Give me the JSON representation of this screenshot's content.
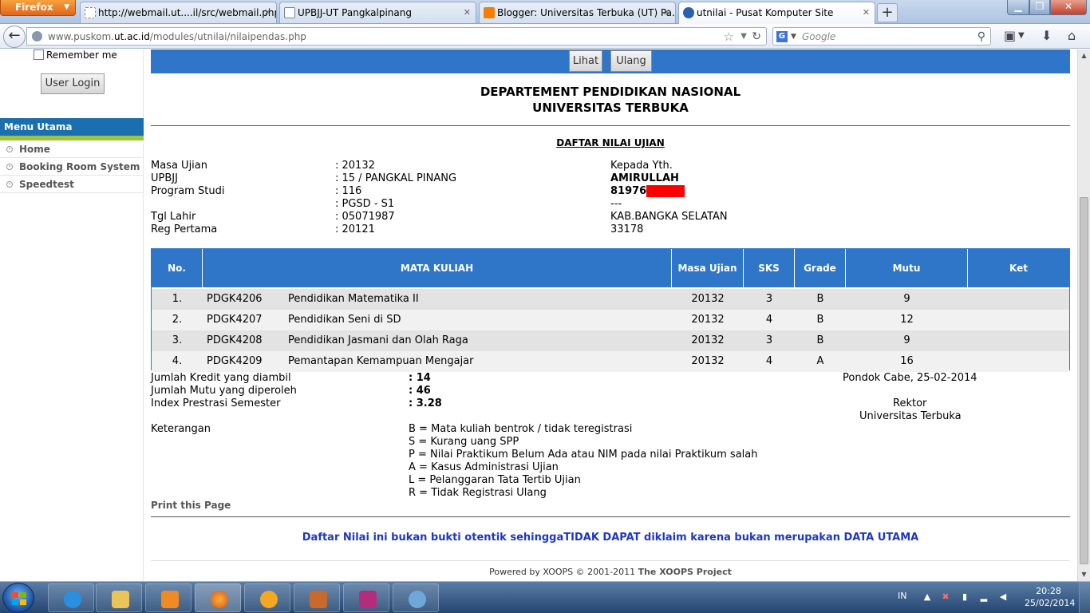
{
  "browser": {
    "firefox_label": "Firefox",
    "tabs": [
      {
        "title": "http://webmail.ut....il/src/webmail.php"
      },
      {
        "title": "UPBJJ-UT Pangkalpinang"
      },
      {
        "title": "Blogger: Universitas Terbuka (UT) Pa..."
      },
      {
        "title": "utnilai - Pusat Komputer Site"
      }
    ],
    "url_prefix": "www.puskom.",
    "url_domain": "ut.ac.id",
    "url_suffix": "/modules/utnilai/nilaipendas.php",
    "search_placeholder": "Google",
    "search_engine_letter": "G"
  },
  "sidebar": {
    "remember_label": "Remember me",
    "login_label": "User Login",
    "menu_title": "Menu Utama",
    "items": [
      {
        "label": "Home"
      },
      {
        "label": "Booking Room System"
      },
      {
        "label": "Speedtest"
      }
    ]
  },
  "page": {
    "btn_lihat": "Lihat",
    "btn_ulang": "Ulang",
    "dept_line1": "DEPARTEMENT PENDIDIKAN NASIONAL",
    "dept_line2": "UNIVERSITAS TERBUKA",
    "daftar_title": "DAFTAR NILAI UJIAN",
    "info": {
      "masa_label": "Masa Ujian",
      "masa_value": ": 20132",
      "upbjj_label": "UPBJJ",
      "upbjj_value": ": 15 / PANGKAL PINANG",
      "prodi_label": "Program Studi",
      "prodi_value": ": 116",
      "prodi_value2": ": PGSD - S1",
      "tgl_label": "Tgl Lahir",
      "tgl_value": ": 05071987",
      "reg_label": "Reg Pertama",
      "reg_value": ": 20121",
      "kepada": "Kepada Yth.",
      "name": "AMIRULLAH",
      "nim": "81976",
      "dash": "---",
      "kab": "KAB.BANGKA SELATAN",
      "postal": "33178"
    },
    "table": {
      "headers": {
        "no": "No.",
        "mk": "MATA KULIAH",
        "masa": "Masa Ujian",
        "sks": "SKS",
        "grade": "Grade",
        "mutu": "Mutu",
        "ket": "Ket"
      },
      "rows": [
        {
          "no": "1.",
          "kode": "PDGK4206",
          "nama": "Pendidikan Matematika II",
          "masa": "20132",
          "sks": "3",
          "grade": "B",
          "mutu": "9"
        },
        {
          "no": "2.",
          "kode": "PDGK4207",
          "nama": "Pendidikan Seni di SD",
          "masa": "20132",
          "sks": "4",
          "grade": "B",
          "mutu": "12"
        },
        {
          "no": "3.",
          "kode": "PDGK4208",
          "nama": "Pendidikan Jasmani dan Olah Raga",
          "masa": "20132",
          "sks": "3",
          "grade": "B",
          "mutu": "9"
        },
        {
          "no": "4.",
          "kode": "PDGK4209",
          "nama": "Pemantapan Kemampuan Mengajar",
          "masa": "20132",
          "sks": "4",
          "grade": "A",
          "mutu": "16"
        }
      ]
    },
    "summary": {
      "kredit_label": "Jumlah Kredit yang diambil",
      "kredit_value": ": 14",
      "mutu_label": "Jumlah Mutu yang diperoleh",
      "mutu_value": ": 46",
      "ips_label": "Index Prestrasi Semester",
      "ips_value": ": 3.28",
      "place_date": "Pondok Cabe, 25-02-2014",
      "rektor": "Rektor",
      "univ": "Universitas Terbuka"
    },
    "keterangan_label": "Keterangan",
    "legend": [
      "B = Mata kuliah bentrok / tidak teregistrasi",
      "S = Kurang uang SPP",
      "P = Nilai Praktikum Belum Ada atau NIM pada nilai Praktikum salah",
      "A = Kasus Administrasi Ujian",
      "L = Pelanggaran Tata Tertib Ujian",
      "R = Tidak Registrasi Ulang"
    ],
    "print_label": "Print this Page",
    "warning": "Daftar Nilai ini bukan bukti otentik sehinggaTIDAK DAPAT diklaim karena bukan merupakan DATA UTAMA",
    "powered_prefix": "Powered by XOOPS © 2001-2011 ",
    "powered_project": "The XOOPS Project"
  },
  "taskbar": {
    "lang": "IN",
    "time": "20:28",
    "date": "25/02/2014"
  },
  "colors": {
    "band_blue": "#2f76c8",
    "menu_blue": "#1b6fae",
    "menu_green": "#9ec33f",
    "warning_blue": "#1f36c4",
    "redaction": "#ff0000"
  }
}
